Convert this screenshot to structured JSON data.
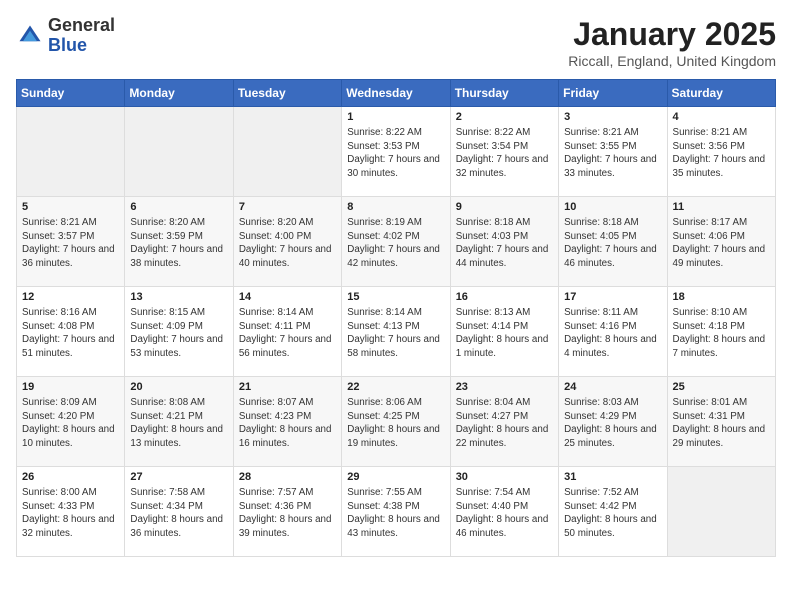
{
  "logo": {
    "general": "General",
    "blue": "Blue"
  },
  "header": {
    "month": "January 2025",
    "location": "Riccall, England, United Kingdom"
  },
  "days_of_week": [
    "Sunday",
    "Monday",
    "Tuesday",
    "Wednesday",
    "Thursday",
    "Friday",
    "Saturday"
  ],
  "weeks": [
    [
      {
        "day": null
      },
      {
        "day": null
      },
      {
        "day": null
      },
      {
        "day": "1",
        "sunrise": "8:22 AM",
        "sunset": "3:53 PM",
        "daylight": "7 hours and 30 minutes."
      },
      {
        "day": "2",
        "sunrise": "8:22 AM",
        "sunset": "3:54 PM",
        "daylight": "7 hours and 32 minutes."
      },
      {
        "day": "3",
        "sunrise": "8:21 AM",
        "sunset": "3:55 PM",
        "daylight": "7 hours and 33 minutes."
      },
      {
        "day": "4",
        "sunrise": "8:21 AM",
        "sunset": "3:56 PM",
        "daylight": "7 hours and 35 minutes."
      }
    ],
    [
      {
        "day": "5",
        "sunrise": "8:21 AM",
        "sunset": "3:57 PM",
        "daylight": "7 hours and 36 minutes."
      },
      {
        "day": "6",
        "sunrise": "8:20 AM",
        "sunset": "3:59 PM",
        "daylight": "7 hours and 38 minutes."
      },
      {
        "day": "7",
        "sunrise": "8:20 AM",
        "sunset": "4:00 PM",
        "daylight": "7 hours and 40 minutes."
      },
      {
        "day": "8",
        "sunrise": "8:19 AM",
        "sunset": "4:02 PM",
        "daylight": "7 hours and 42 minutes."
      },
      {
        "day": "9",
        "sunrise": "8:18 AM",
        "sunset": "4:03 PM",
        "daylight": "7 hours and 44 minutes."
      },
      {
        "day": "10",
        "sunrise": "8:18 AM",
        "sunset": "4:05 PM",
        "daylight": "7 hours and 46 minutes."
      },
      {
        "day": "11",
        "sunrise": "8:17 AM",
        "sunset": "4:06 PM",
        "daylight": "7 hours and 49 minutes."
      }
    ],
    [
      {
        "day": "12",
        "sunrise": "8:16 AM",
        "sunset": "4:08 PM",
        "daylight": "7 hours and 51 minutes."
      },
      {
        "day": "13",
        "sunrise": "8:15 AM",
        "sunset": "4:09 PM",
        "daylight": "7 hours and 53 minutes."
      },
      {
        "day": "14",
        "sunrise": "8:14 AM",
        "sunset": "4:11 PM",
        "daylight": "7 hours and 56 minutes."
      },
      {
        "day": "15",
        "sunrise": "8:14 AM",
        "sunset": "4:13 PM",
        "daylight": "7 hours and 58 minutes."
      },
      {
        "day": "16",
        "sunrise": "8:13 AM",
        "sunset": "4:14 PM",
        "daylight": "8 hours and 1 minute."
      },
      {
        "day": "17",
        "sunrise": "8:11 AM",
        "sunset": "4:16 PM",
        "daylight": "8 hours and 4 minutes."
      },
      {
        "day": "18",
        "sunrise": "8:10 AM",
        "sunset": "4:18 PM",
        "daylight": "8 hours and 7 minutes."
      }
    ],
    [
      {
        "day": "19",
        "sunrise": "8:09 AM",
        "sunset": "4:20 PM",
        "daylight": "8 hours and 10 minutes."
      },
      {
        "day": "20",
        "sunrise": "8:08 AM",
        "sunset": "4:21 PM",
        "daylight": "8 hours and 13 minutes."
      },
      {
        "day": "21",
        "sunrise": "8:07 AM",
        "sunset": "4:23 PM",
        "daylight": "8 hours and 16 minutes."
      },
      {
        "day": "22",
        "sunrise": "8:06 AM",
        "sunset": "4:25 PM",
        "daylight": "8 hours and 19 minutes."
      },
      {
        "day": "23",
        "sunrise": "8:04 AM",
        "sunset": "4:27 PM",
        "daylight": "8 hours and 22 minutes."
      },
      {
        "day": "24",
        "sunrise": "8:03 AM",
        "sunset": "4:29 PM",
        "daylight": "8 hours and 25 minutes."
      },
      {
        "day": "25",
        "sunrise": "8:01 AM",
        "sunset": "4:31 PM",
        "daylight": "8 hours and 29 minutes."
      }
    ],
    [
      {
        "day": "26",
        "sunrise": "8:00 AM",
        "sunset": "4:33 PM",
        "daylight": "8 hours and 32 minutes."
      },
      {
        "day": "27",
        "sunrise": "7:58 AM",
        "sunset": "4:34 PM",
        "daylight": "8 hours and 36 minutes."
      },
      {
        "day": "28",
        "sunrise": "7:57 AM",
        "sunset": "4:36 PM",
        "daylight": "8 hours and 39 minutes."
      },
      {
        "day": "29",
        "sunrise": "7:55 AM",
        "sunset": "4:38 PM",
        "daylight": "8 hours and 43 minutes."
      },
      {
        "day": "30",
        "sunrise": "7:54 AM",
        "sunset": "4:40 PM",
        "daylight": "8 hours and 46 minutes."
      },
      {
        "day": "31",
        "sunrise": "7:52 AM",
        "sunset": "4:42 PM",
        "daylight": "8 hours and 50 minutes."
      },
      {
        "day": null
      }
    ]
  ]
}
